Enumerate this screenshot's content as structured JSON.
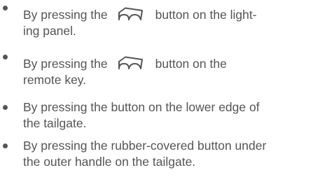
{
  "items": [
    {
      "line1_before": "By pressing the",
      "icon": "tailgate-icon",
      "line1_after": "button on the light-",
      "line2": "ing panel."
    },
    {
      "line1_before": "By pressing the",
      "icon": "tailgate-icon",
      "line1_after": "button on the",
      "line2": "remote key."
    },
    {
      "line1": "By pressing the button on the lower edge of",
      "line2": "the tailgate."
    },
    {
      "line1": "By pressing the rubber-covered button under",
      "line2": "the outer handle on the tailgate."
    }
  ]
}
